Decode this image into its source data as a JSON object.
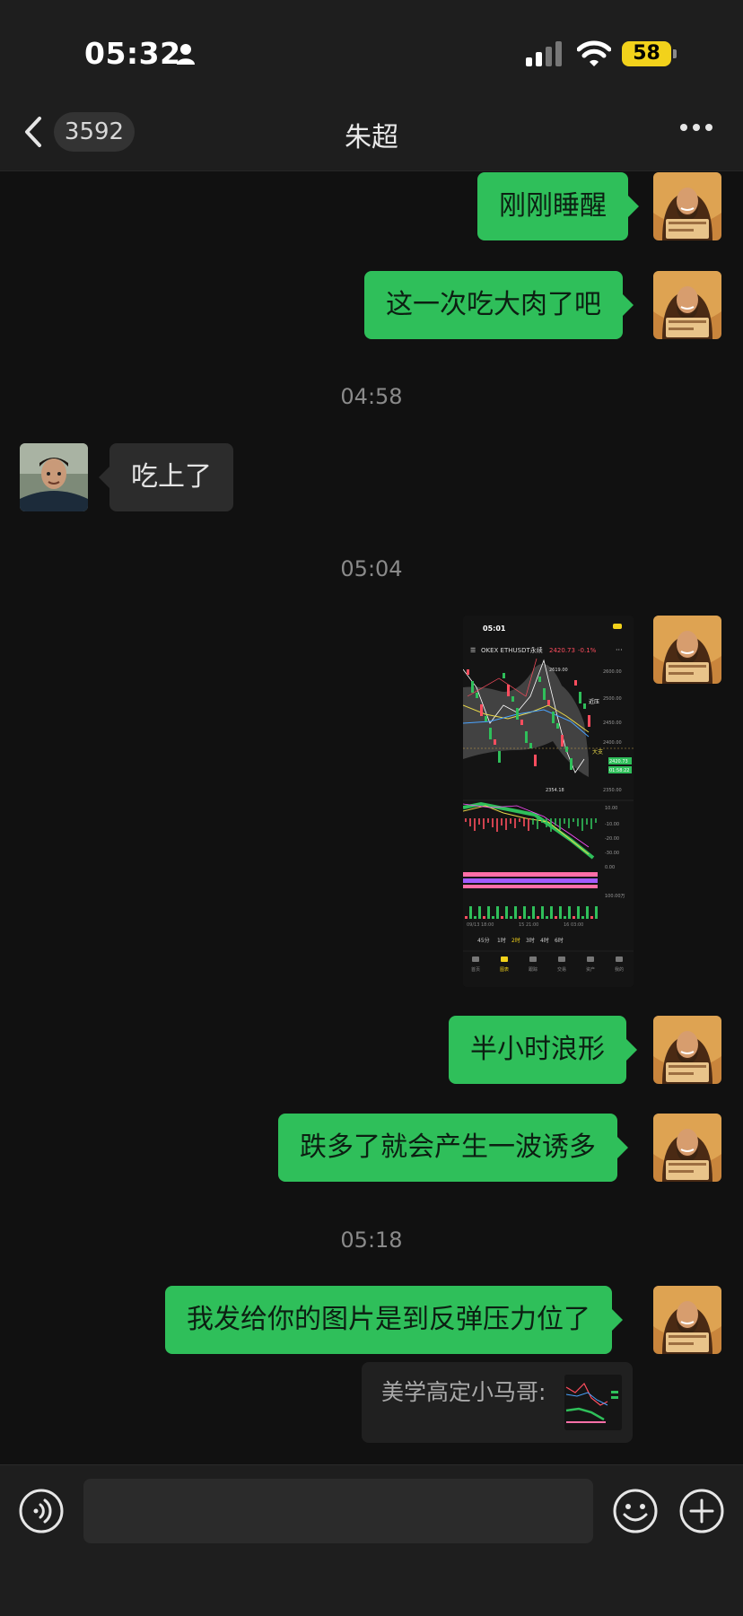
{
  "status_bar": {
    "time": "05:32",
    "battery": "58"
  },
  "header": {
    "unread_count": "3592",
    "contact_name": "朱超"
  },
  "messages": [
    {
      "text": "刚刚睡醒"
    },
    {
      "text": "这一次吃大肉了吧"
    },
    {
      "time": "04:58"
    },
    {
      "text": "吃上了"
    },
    {
      "time": "05:04"
    },
    {
      "image": {
        "status_time": "05:01",
        "title": "OKEX ETHUSDT永续",
        "price": "2420.73",
        "change": "-0.1%",
        "price_labels": [
          "2600.00",
          "2500.00",
          "2450.00",
          "2400.00",
          "2350.00"
        ],
        "annotations": [
          "近压",
          "大支"
        ],
        "tag_price": "2420.73",
        "tag_sub": "01:58:22",
        "low_label": "2354.18",
        "high_label": "2619.00",
        "macd_labels": [
          "10.00",
          "-10.00",
          "-20.00",
          "-30.00",
          "0.00"
        ],
        "vol_label": "100.00万",
        "x_labels": [
          "09/13 18:00",
          "15 21:00",
          "16 03:00"
        ],
        "timeframes": [
          "45分",
          "1时",
          "2时",
          "3时",
          "4时",
          "6时"
        ],
        "bottom_nav": [
          "首页",
          "图表",
          "跟踪",
          "交易",
          "资产",
          "我的"
        ]
      }
    },
    {
      "text": "半小时浪形"
    },
    {
      "text": "跌多了就会产生一波诱多"
    },
    {
      "time": "05:18"
    },
    {
      "text": "我发给你的图片是到反弹压力位了"
    },
    {
      "quote": {
        "sender": "美学高定小马哥:"
      }
    }
  ],
  "composer": {
    "placeholder": ""
  }
}
